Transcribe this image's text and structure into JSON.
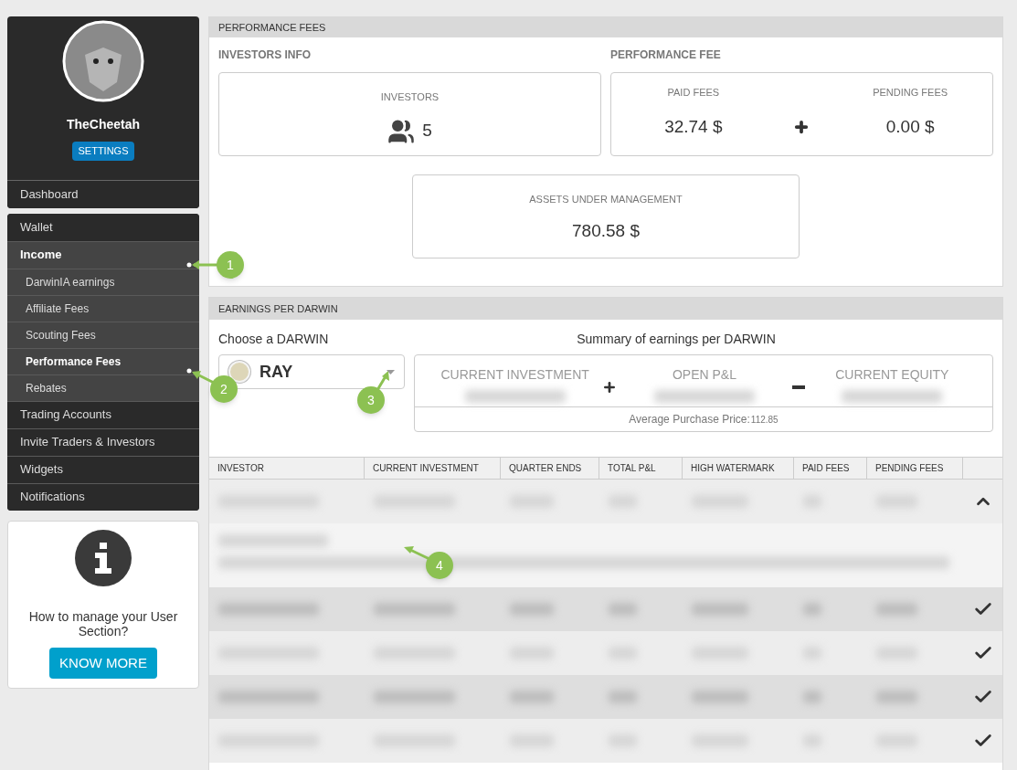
{
  "profile": {
    "username": "TheCheetah",
    "settings_button": "SETTINGS"
  },
  "nav_top": [
    {
      "label": "Dashboard",
      "selected": false
    }
  ],
  "nav": [
    {
      "label": "Wallet",
      "kind": "main",
      "selected": false
    },
    {
      "label": "Income",
      "kind": "main",
      "selected": true
    },
    {
      "label": "DarwinIA earnings",
      "kind": "sub",
      "selected": false
    },
    {
      "label": "Affiliate Fees",
      "kind": "sub",
      "selected": false
    },
    {
      "label": "Scouting Fees",
      "kind": "sub",
      "selected": false
    },
    {
      "label": "Performance Fees",
      "kind": "sub",
      "selected": true
    },
    {
      "label": "Rebates",
      "kind": "sub",
      "selected": false
    },
    {
      "label": "Trading Accounts",
      "kind": "main",
      "selected": false
    },
    {
      "label": "Invite Traders & Investors",
      "kind": "main",
      "selected": false
    },
    {
      "label": "Widgets",
      "kind": "main",
      "selected": false
    },
    {
      "label": "Notifications",
      "kind": "main",
      "selected": false
    }
  ],
  "help_card": {
    "text": "How to manage your User Section?",
    "button": "KNOW MORE"
  },
  "performance_fees": {
    "title": "PERFORMANCE FEES",
    "investors_heading": "INVESTORS INFO",
    "investors_label": "INVESTORS",
    "investors_count": "5",
    "fee_heading": "PERFORMANCE FEE",
    "paid_label": "PAID FEES",
    "paid_value": "32.74 $",
    "pending_label": "PENDING FEES",
    "pending_value": "0.00 $",
    "aum_label": "ASSETS UNDER MANAGEMENT",
    "aum_value": "780.58 $"
  },
  "earnings": {
    "title": "EARNINGS PER DARWIN",
    "choose_label": "Choose a DARWIN",
    "darwin": "RAY",
    "summary_title": "Summary of earnings per DARWIN",
    "summary_columns": [
      "CURRENT INVESTMENT",
      "OPEN P&L",
      "CURRENT EQUITY"
    ],
    "avg_label": "Average Purchase Price:",
    "avg_value": "112.85"
  },
  "table": {
    "columns": [
      "INVESTOR",
      "CURRENT INVESTMENT",
      "QUARTER ENDS",
      "TOTAL P&L",
      "HIGH WATERMARK",
      "PAID FEES",
      "PENDING FEES"
    ],
    "rows": [
      {
        "expanded": true
      },
      {
        "expanded": false
      },
      {
        "expanded": false
      },
      {
        "expanded": false
      },
      {
        "expanded": false
      }
    ]
  },
  "callouts": [
    "1",
    "2",
    "3",
    "4"
  ]
}
